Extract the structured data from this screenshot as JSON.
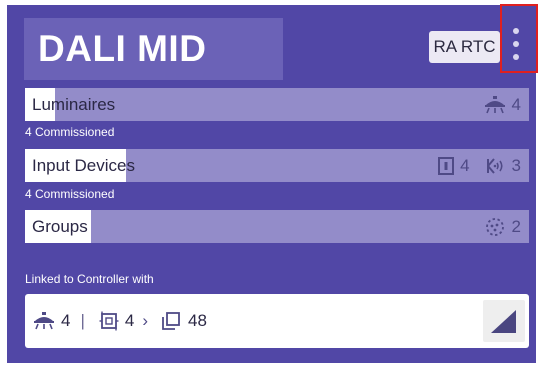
{
  "header": {
    "title": "DALI MID",
    "rtc_chip": "RA RTC"
  },
  "rows": [
    {
      "label": "Luminaires",
      "progress": 0.06,
      "subtext": "4 Commissioned",
      "counts": [
        {
          "icon": "ceiling-lamp-icon",
          "value": "4"
        }
      ]
    },
    {
      "label": "Input Devices",
      "progress": 0.2,
      "subtext": "4 Commissioned",
      "counts": [
        {
          "icon": "push-button-icon",
          "value": "4"
        },
        {
          "icon": "wireless-sensor-icon",
          "value": "3"
        }
      ]
    },
    {
      "label": "Groups",
      "progress": 0.13,
      "counts": [
        {
          "icon": "group-dots-icon",
          "value": "2"
        }
      ]
    }
  ],
  "linked": {
    "label": "Linked to Controller with",
    "luminaires": "4",
    "separator": "|",
    "devices": "4",
    "chevron": "›",
    "pages": "48"
  },
  "colors": {
    "card_bg": "#5147a6",
    "title_box": "#6b62b7",
    "row_track": "#938cc9",
    "highlight": "#e02020"
  }
}
